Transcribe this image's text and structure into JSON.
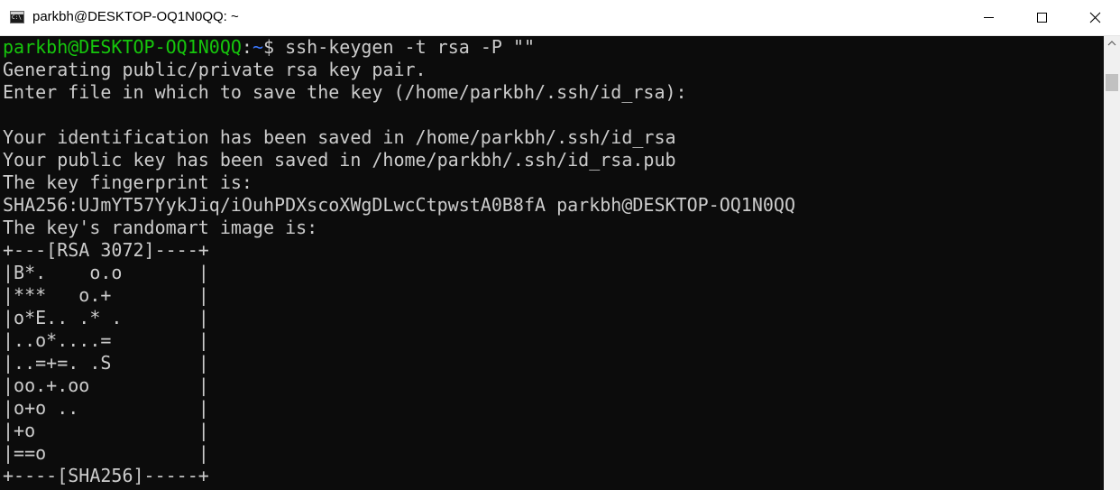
{
  "window": {
    "title": "parkbh@DESKTOP-OQ1N0QQ: ~",
    "icon": "cmd-terminal-icon",
    "icon_glyph": "C:\\"
  },
  "controls": {
    "minimize_icon": "minimize-icon",
    "maximize_icon": "maximize-icon",
    "close_icon": "close-icon"
  },
  "colors": {
    "terminal_bg": "#0c0c0c",
    "terminal_fg": "#cccccc",
    "prompt_user": "#16c60c",
    "prompt_path": "#3b78ff"
  },
  "terminal": {
    "prompt": {
      "user_host": "parkbh@DESKTOP-OQ1N0QQ",
      "separator": ":",
      "path": "~",
      "symbol": "$ ",
      "command": "ssh-keygen -t rsa -P \"\""
    },
    "output": [
      "Generating public/private rsa key pair.",
      "Enter file in which to save the key (/home/parkbh/.ssh/id_rsa):",
      "",
      "Your identification has been saved in /home/parkbh/.ssh/id_rsa",
      "Your public key has been saved in /home/parkbh/.ssh/id_rsa.pub",
      "The key fingerprint is:",
      "SHA256:UJmYT57YykJiq/iOuhPDXscoXWgDLwcCtpwstA0B8fA parkbh@DESKTOP-OQ1N0QQ",
      "The key's randomart image is:",
      "+---[RSA 3072]----+",
      "|B*.    o.o       |",
      "|***   o.+        |",
      "|o*E.. .* .       |",
      "|..o*....=        |",
      "|..=+=. .S        |",
      "|oo.+.oo          |",
      "|o+o ..           |",
      "|+o               |",
      "|==o              |",
      "+----[SHA256]-----+"
    ]
  }
}
